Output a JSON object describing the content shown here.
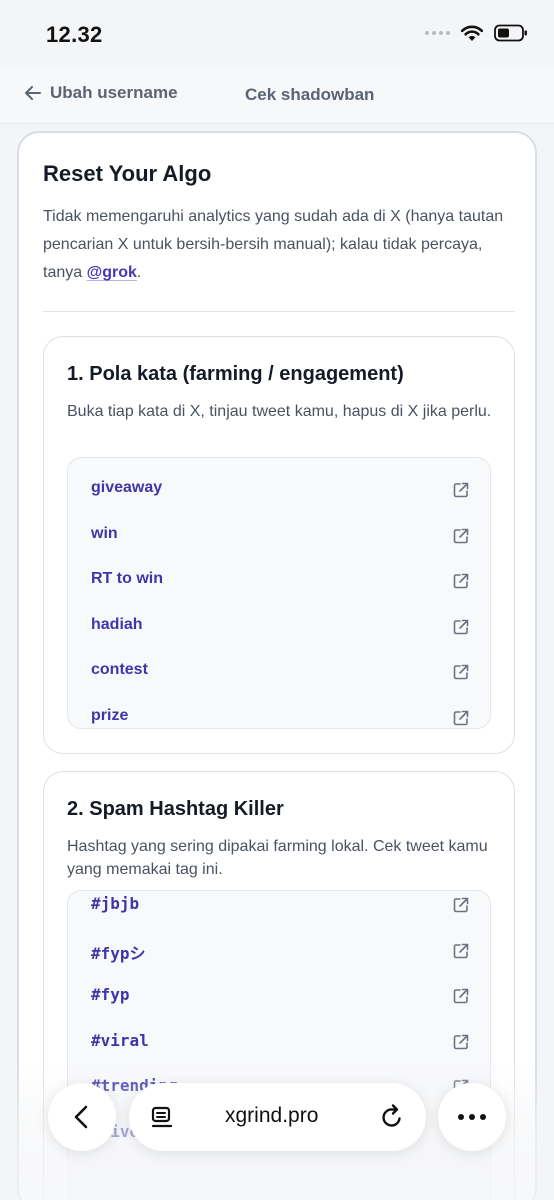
{
  "status_bar": {
    "time": "12.32"
  },
  "nav": {
    "back_label": "Ubah username",
    "shadowban_label": "Cek shadowban"
  },
  "card": {
    "title": "Reset Your Algo",
    "desc_before": "Tidak memengaruhi analytics yang sudah ada di X (hanya tautan pencarian X untuk bersih-bersih manual); kalau tidak percaya, tanya ",
    "grok_link": "@grok",
    "desc_after": "."
  },
  "section1": {
    "title": "1. Pola kata (farming / engagement)",
    "desc": "Buka tiap kata di X, tinjau tweet kamu, hapus di X jika perlu.",
    "words": [
      "giveaway",
      "win",
      "RT to win",
      "hadiah",
      "contest",
      "prize"
    ]
  },
  "section2": {
    "title": "2. Spam Hashtag Killer",
    "desc": "Hashtag yang sering dipakai farming lokal. Cek tweet kamu yang memakai tag ini.",
    "tags": [
      "#jbjb",
      "#fypシ",
      "#fyp",
      "#viral",
      "#trending",
      "#livetok"
    ]
  },
  "browser": {
    "url": "xgrind.pro"
  },
  "colors": {
    "accent": "#3f36a8",
    "text": "#151b26",
    "muted": "#4a5262"
  },
  "icons": [
    "wifi-icon",
    "battery-icon",
    "arrow-left-icon",
    "external-link-icon",
    "chevron-left-icon",
    "tabs-icon",
    "reload-icon",
    "more-icon"
  ]
}
